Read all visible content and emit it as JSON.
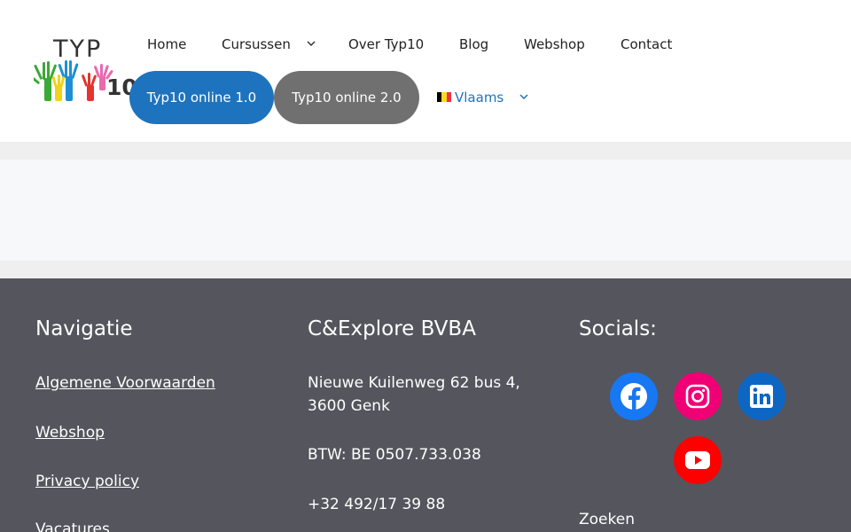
{
  "logo": {
    "text": "TYP",
    "number": "10",
    "hand_colors": [
      "#3aa935",
      "#1e8fd5",
      "#f2d21a",
      "#e3342f",
      "#e86ab0"
    ]
  },
  "nav": {
    "items": [
      {
        "label": "Home"
      },
      {
        "label": "Cursussen",
        "has_dropdown": true
      },
      {
        "label": "Over Typ10"
      },
      {
        "label": "Blog"
      },
      {
        "label": "Webshop"
      },
      {
        "label": "Contact"
      }
    ],
    "pills": [
      {
        "label": "Typ10 online 1.0",
        "color": "#1e73be"
      },
      {
        "label": "Typ10 online 2.0",
        "color": "#707070"
      }
    ],
    "language": {
      "label": "Vlaams",
      "flag": "belgium-flag-icon",
      "color": "#1e73be"
    },
    "dropdown_icon": "chevron-down-icon"
  },
  "footer": {
    "navigation": {
      "title": "Navigatie",
      "links": [
        "Algemene Voorwaarden",
        "Webshop",
        "Privacy policy",
        "Vacatures"
      ]
    },
    "company": {
      "title": "C&Explore BVBA",
      "address_line1": "Nieuwe Kuilenweg 62 bus 4,",
      "address_line2": "3600 Genk",
      "vat": "BTW: BE 0507.733.038",
      "phone": "+32 492/17 39 88"
    },
    "socials": {
      "title": "Socials:",
      "icons": [
        "facebook-icon",
        "instagram-icon",
        "linkedin-icon",
        "youtube-icon"
      ],
      "search_label": "Zoeken"
    },
    "background": "#55555e"
  }
}
